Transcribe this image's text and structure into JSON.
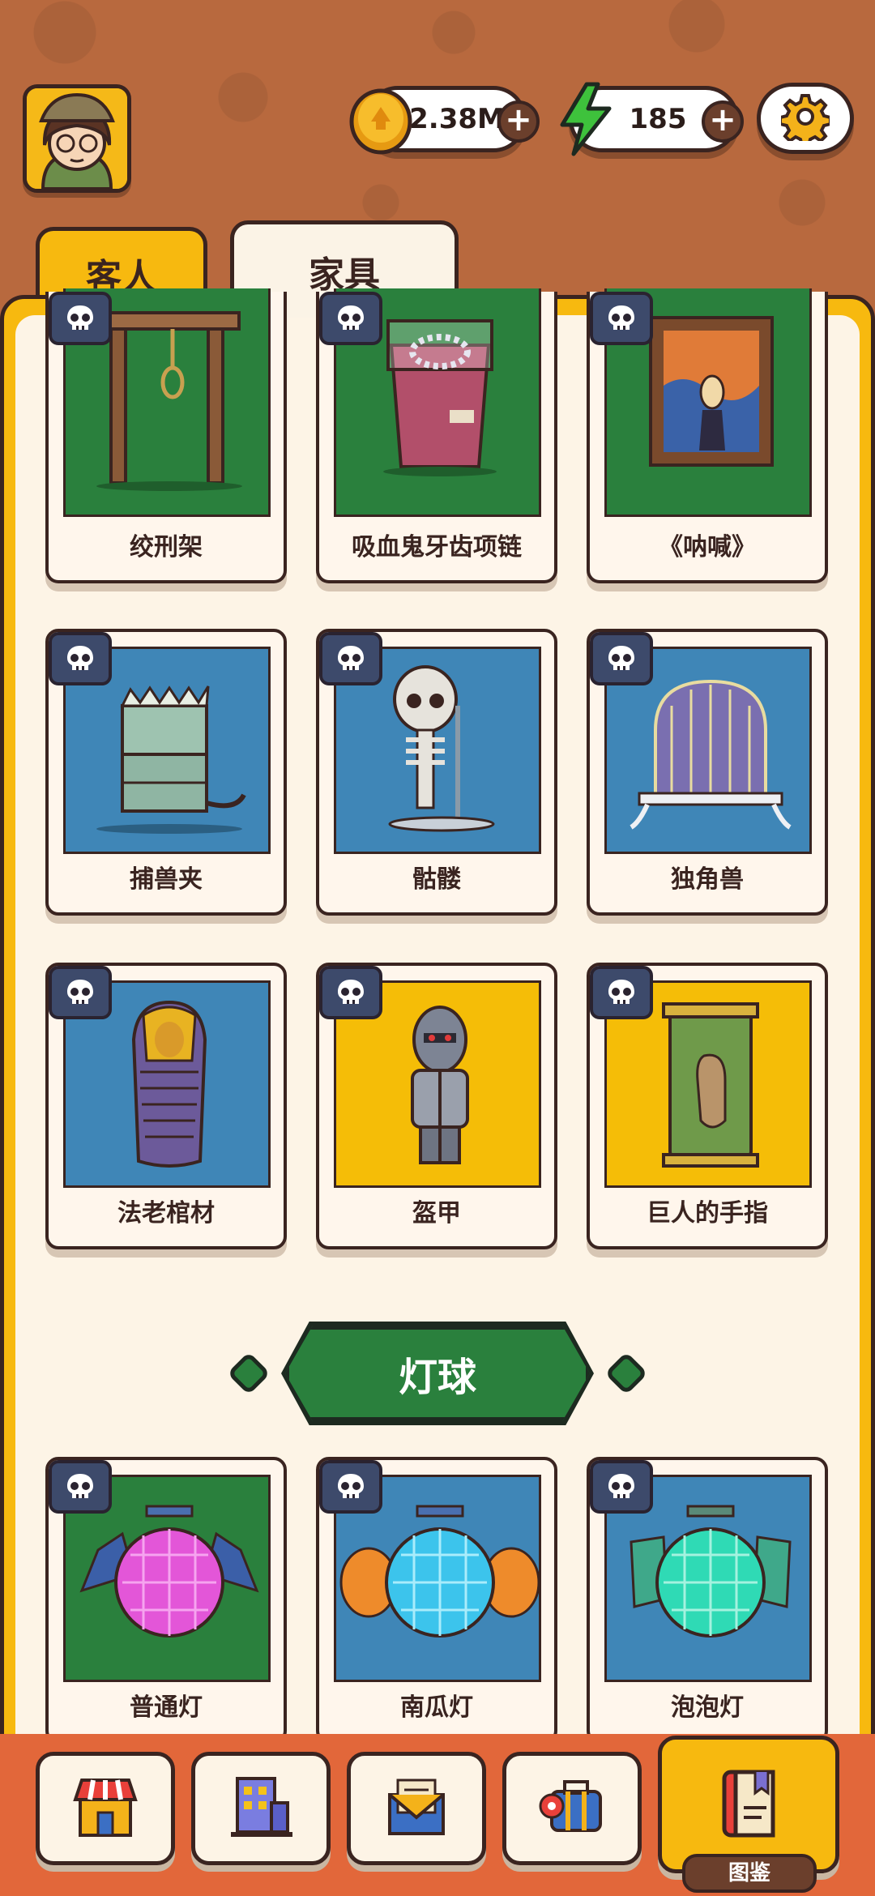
{
  "header": {
    "coins": "2.38M",
    "energy": "185"
  },
  "tabs": [
    {
      "label": "客人",
      "active": false
    },
    {
      "label": "家具",
      "active": true
    }
  ],
  "rows": [
    [
      "绞刑架",
      "吸血鬼牙齿项链",
      "《呐喊》"
    ],
    [
      "捕兽夹",
      "骷髅",
      "独角兽"
    ],
    [
      "法老棺材",
      "盔甲",
      "巨人的手指"
    ]
  ],
  "section": {
    "title": "灯球",
    "items": [
      "普通灯",
      "南瓜灯",
      "泡泡灯"
    ]
  },
  "nav": {
    "active_label": "图鉴"
  },
  "colors": {
    "accent_yellow": "#f7b90f",
    "card_green": "#2a803d",
    "card_blue": "#3f86b7",
    "card_yellow": "#f5bd07",
    "outline": "#3a2420"
  },
  "icons": [
    "avatar",
    "coin-icon",
    "energy-icon",
    "gear-icon",
    "skull-icon",
    "shop-icon",
    "building-icon",
    "mail-icon",
    "travel-icon",
    "book-icon"
  ]
}
